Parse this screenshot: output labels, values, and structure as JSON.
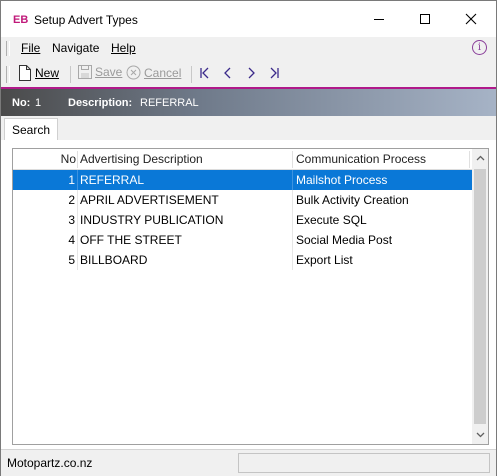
{
  "window": {
    "badge": "EB",
    "title": "Setup Advert Types"
  },
  "menu": {
    "items": [
      "File",
      "Navigate",
      "Help"
    ]
  },
  "toolbar": {
    "new_label": "New",
    "save_label": "Save",
    "cancel_label": "Cancel"
  },
  "record": {
    "no_label": "No:",
    "no_value": "1",
    "desc_label": "Description:",
    "desc_value": "REFERRAL"
  },
  "tabs": [
    "Search"
  ],
  "grid": {
    "columns": [
      "No",
      "Advertising Description",
      "Communication Process"
    ],
    "rows": [
      {
        "no": "1",
        "description": "REFERRAL",
        "process": "Mailshot Process",
        "selected": true
      },
      {
        "no": "2",
        "description": "APRIL ADVERTISEMENT",
        "process": "Bulk Activity Creation",
        "selected": false
      },
      {
        "no": "3",
        "description": "INDUSTRY PUBLICATION",
        "process": "Execute SQL",
        "selected": false
      },
      {
        "no": "4",
        "description": "OFF THE STREET",
        "process": "Social Media Post",
        "selected": false
      },
      {
        "no": "5",
        "description": "BILLBOARD",
        "process": "Export List",
        "selected": false
      }
    ]
  },
  "status": {
    "text": "Motopartz.co.nz"
  },
  "colors": {
    "accent": "#b0198a",
    "selection": "#0a78d7",
    "badge": "#c0197a",
    "nav_arrows": "#3b2a8a"
  }
}
